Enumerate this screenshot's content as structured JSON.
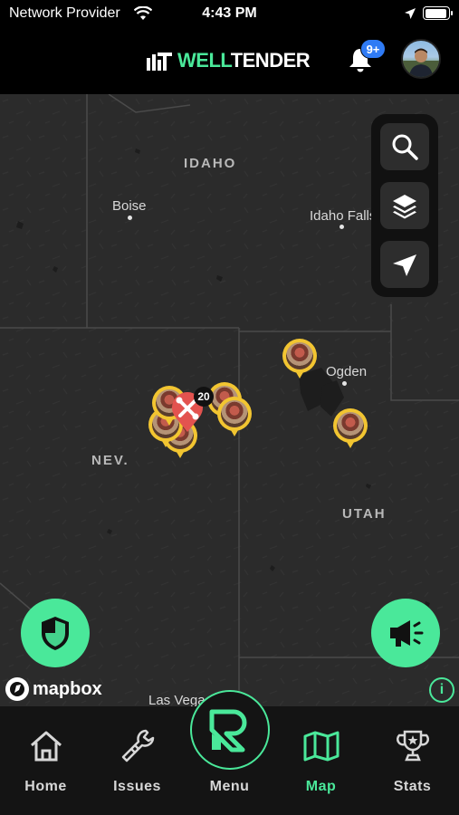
{
  "status_bar": {
    "carrier": "Network Provider",
    "time": "4:43 PM",
    "battery_level": 0.95
  },
  "header": {
    "brand_well": "WELL",
    "brand_tender": "TENDER",
    "notification_badge": "9+",
    "avatar": "profile-photo"
  },
  "map": {
    "regions": [
      "IDAHO",
      "NEV.",
      "UTAH"
    ],
    "cities": [
      "Boise",
      "Idaho Falls",
      "Ogden",
      "Las Vegas"
    ],
    "cluster_count": "20",
    "attribution": "mapbox",
    "tools": [
      "search-icon",
      "layers-icon",
      "location-arrow-icon"
    ],
    "pin_color": "#f2c531",
    "issue_marker_color": "#e3534f"
  },
  "tabs": [
    {
      "label": "Home",
      "icon": "home-icon"
    },
    {
      "label": "Issues",
      "icon": "wrench-icon"
    },
    {
      "label": "Menu",
      "icon": "menu-logo-icon"
    },
    {
      "label": "Map",
      "icon": "map-icon",
      "active": true
    },
    {
      "label": "Stats",
      "icon": "trophy-icon"
    }
  ],
  "colors": {
    "accent": "#4ae89a",
    "badge": "#2f7bf5",
    "map_bg": "#2b2b2b"
  }
}
